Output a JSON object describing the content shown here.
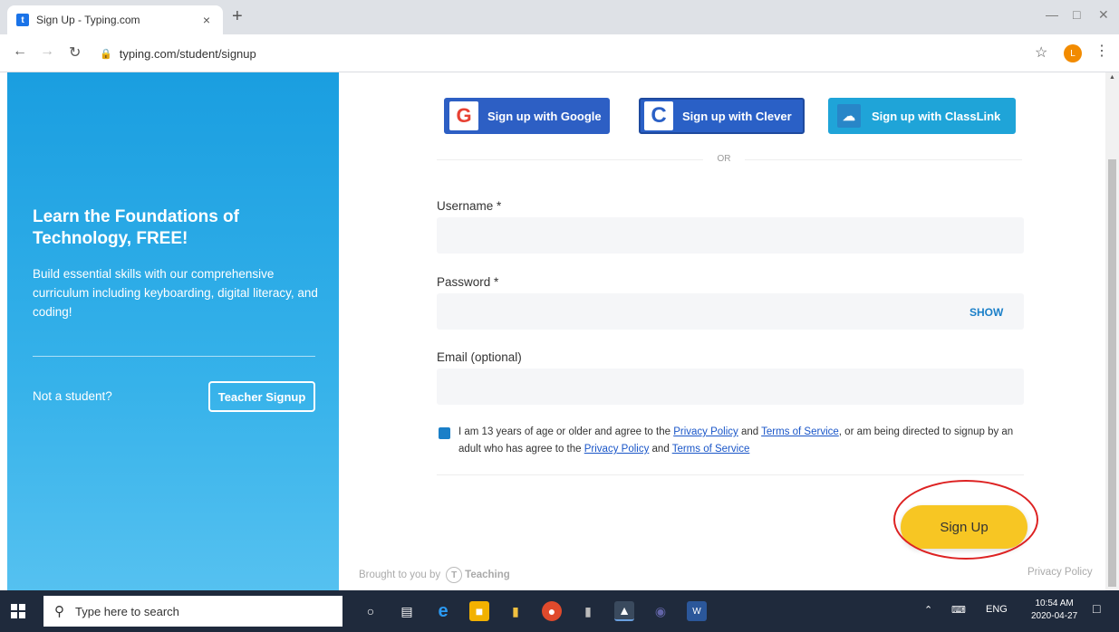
{
  "browser": {
    "tab_title": "Sign Up - Typing.com",
    "tab_close": "×",
    "new_tab": "+",
    "url": "typing.com/student/signup",
    "favicon_letter": "t",
    "profile_letter": "L"
  },
  "left_panel": {
    "headline": "Learn the Foundations of Technology, FREE!",
    "description": "Build essential skills with our comprehensive curriculum including keyboarding, digital literacy, and coding!",
    "not_student": "Not a student?",
    "teacher_signup": "Teacher Signup"
  },
  "form": {
    "sso_google": "Sign up with Google",
    "sso_clever": "Sign up with Clever",
    "sso_classlink": "Sign up with ClassLink",
    "or": "OR",
    "username_label": "Username *",
    "password_label": "Password *",
    "show": "SHOW",
    "email_label": "Email (optional)",
    "terms_1": "I am 13 years of age or older and agree to the ",
    "privacy_link": "Privacy Policy",
    "and": " and ",
    "terms_link": "Terms of Service",
    "terms_2": ", or am being directed to signup by an adult who has agree to the ",
    "signup_button": "Sign Up"
  },
  "footer": {
    "brought_by": "Brought to you by",
    "brand": "Teaching",
    "privacy": "Privacy Policy"
  },
  "taskbar": {
    "search_placeholder": "Type here to search",
    "lang": "ENG",
    "time": "10:54 AM",
    "date": "2020-04-27"
  },
  "colors": {
    "panel_blue": "#1a9ee0",
    "signup_yellow": "#f7c623",
    "google_blue": "#2d5fc4",
    "classlink_blue": "#1fa4d8",
    "highlight_red": "#d22"
  }
}
